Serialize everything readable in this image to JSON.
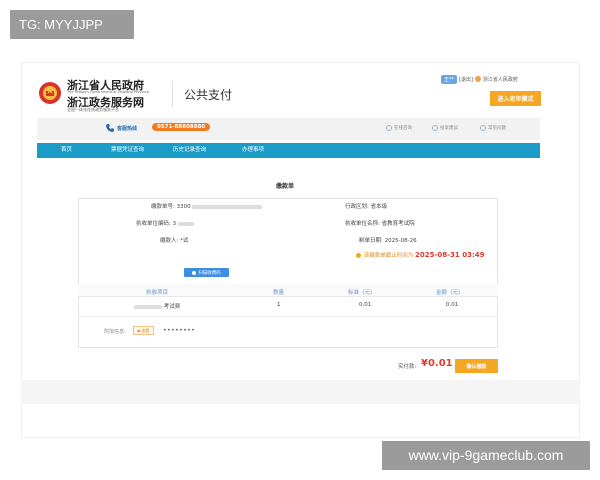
{
  "overlay": {
    "top_tag": "TG: MYYJJPP",
    "watermark": "www.vip-9gameclub.com"
  },
  "header": {
    "gov_name": "浙江省人民政府",
    "gov_name_en": "The People's Government of Zhejiang Province",
    "service_name": "浙江政务服务网",
    "slogan": "全国一体化在线政务服务平台",
    "page_title": "公共支付",
    "user_name": "王**",
    "logout": "[退出]",
    "region": "浙江省人民政府",
    "elder_mode": "进入老年模式"
  },
  "service_bar": {
    "hotline_label": "客服热线",
    "hotline_number": "0571-88808880",
    "links": [
      "在线咨询",
      "投诉建议",
      "常见问题"
    ]
  },
  "nav": {
    "items": [
      "首页",
      "票据凭证查询",
      "历史记录查询",
      "办理事项"
    ]
  },
  "bill": {
    "title": "缴款单",
    "bill_no_label": "缴款单号:",
    "bill_no_value": "3300",
    "admin_region_label": "行政区划:",
    "admin_region_value": "省本级",
    "unit_code_label": "执收单位编码:",
    "unit_code_value": "3",
    "unit_name_label": "执收单位名称:",
    "unit_name_value": "省教育考试院",
    "payer_label": "缴款人:",
    "payer_value": "*试",
    "date_label": "制单日期:",
    "date_value": "2025-08-26",
    "deadline_label": "该缴款单截止时间为",
    "deadline_value": "2025-08-31 03:49",
    "scan_button": "扫描收费码"
  },
  "table": {
    "headers": [
      "执收项目",
      "数量",
      "标准（元）",
      "金额（元）"
    ],
    "rows": [
      {
        "item": "考试费",
        "qty": "1",
        "standard": "0.01",
        "amount": "0.01"
      }
    ]
  },
  "attach": {
    "label": "附加信息:",
    "chip": "查看",
    "value": "••••••••"
  },
  "total": {
    "label": "实付款:",
    "value": "¥0.01",
    "confirm": "确认缴款"
  },
  "colors": {
    "nav": "#1b9cc6",
    "accent_orange": "#f5a623",
    "price_red": "#e03a2a"
  }
}
